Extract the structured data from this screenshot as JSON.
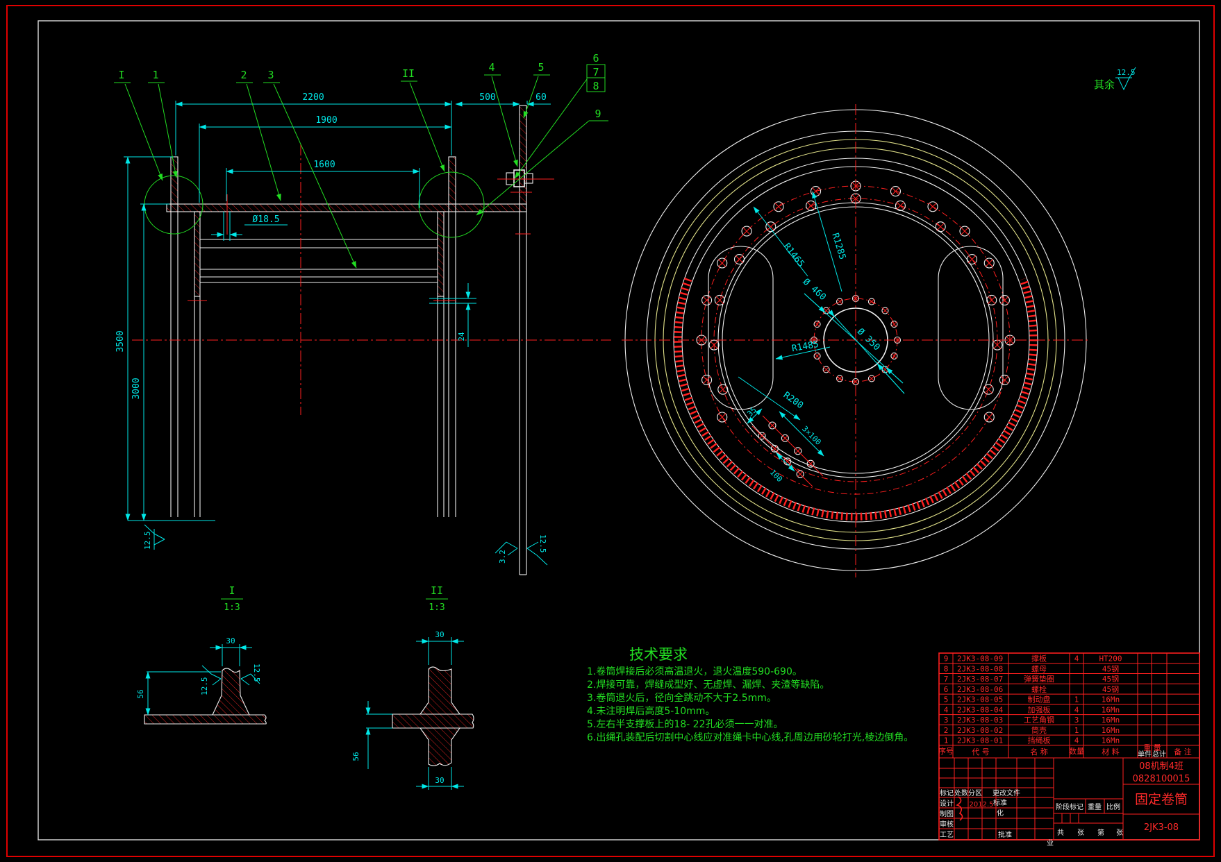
{
  "note": {
    "prefix": "其余",
    "value": "12.5"
  },
  "balloons": {
    "s1": "I",
    "n1": "1",
    "n2": "2",
    "n3": "3",
    "s2": "II",
    "n4": "4",
    "n5": "5",
    "n6": "6",
    "n7": "7",
    "n8": "8",
    "n9": "9"
  },
  "front": {
    "d2200": "2200",
    "d1900": "1900",
    "d1600": "1600",
    "d500": "500",
    "d60": "60",
    "hole": "Ø18.5",
    "v3500": "3500",
    "v3000": "3000",
    "d24": "24",
    "surf_bl": "12.5",
    "surf_32": "3.2",
    "surf_125": "12.5"
  },
  "circle": {
    "r1285": "R1285",
    "r1465": "R1465",
    "d460": "Ø 460",
    "d350": "Ø 350",
    "r1485": "R1485",
    "r200": "R200",
    "d35": "35",
    "d3x100": "3×100",
    "d100": "100"
  },
  "details": {
    "d1": {
      "label": "I",
      "scale": "1:3",
      "w30": "30",
      "h56": "56",
      "sl": "12.5",
      "sr": "12.5"
    },
    "d2": {
      "label": "II",
      "scale": "1:3",
      "wt": "30",
      "wb": "30",
      "h56": "56"
    }
  },
  "tech": {
    "title": "技术要求",
    "lines": [
      "1.卷筒焊接后必须高温退火，退火温度590-690。",
      "2.焊接可靠，焊缝成型好、无虚焊、漏焊、夹渣等缺陷。",
      "3.卷筒退火后，径向全跳动不大于2.5mm。",
      "4.未注明焊后高度5-10mm。",
      "5.左右半支撑板上的18-  22孔必须一一对准。",
      "6.出绳孔装配后切割中心线应对准绳卡中心线,孔周边用砂轮打光,棱边倒角。"
    ]
  },
  "bom": {
    "headers": {
      "no": "序号",
      "code": "代  号",
      "name": "名  称",
      "qty": "数量",
      "material": "材  料",
      "weight": "重 量",
      "weight_sub1": "单件",
      "weight_sub2": "总计",
      "notes": "备 注"
    },
    "rows": [
      {
        "no": "9",
        "code": "2JK3-08-09",
        "name": "撑板",
        "qty": "4",
        "material": "HT200"
      },
      {
        "no": "8",
        "code": "2JK3-08-08",
        "name": "螺母",
        "qty": "",
        "material": "45钢"
      },
      {
        "no": "7",
        "code": "2JK3-08-07",
        "name": "弹簧垫圈",
        "qty": "",
        "material": "45钢"
      },
      {
        "no": "6",
        "code": "2JK3-08-06",
        "name": "螺栓",
        "qty": "",
        "material": "45钢"
      },
      {
        "no": "5",
        "code": "2JK3-08-05",
        "name": "制动盘",
        "qty": "1",
        "material": "16Mn"
      },
      {
        "no": "4",
        "code": "2JK3-08-04",
        "name": "加强板",
        "qty": "4",
        "material": "16Mn"
      },
      {
        "no": "3",
        "code": "2JK3-08-03",
        "name": "工艺角钢",
        "qty": "3",
        "material": "16Mn"
      },
      {
        "no": "2",
        "code": "2JK3-08-02",
        "name": "筒壳",
        "qty": "1",
        "material": "16Mn"
      },
      {
        "no": "1",
        "code": "2JK3-08-01",
        "name": "挡绳板",
        "qty": "4",
        "material": "16Mn"
      }
    ]
  },
  "tb": {
    "mark": "标记",
    "count": "处数",
    "zone": "分区",
    "change_doc": "更改文件",
    "design": "设计",
    "draw": "制图",
    "check": "审核",
    "process": "工艺",
    "standard_1": "标准",
    "standard_2": "化",
    "approve": "批准",
    "sign_date": "2012.5",
    "stage_mark": "阶段标记",
    "weight": "重量",
    "scale": "比例",
    "sheet_total": "共",
    "sheet_zhang1": "张",
    "sheet_page": "第",
    "sheet_zhang2": "张",
    "class_name": "08机制4班",
    "student_id": "0828100015",
    "part_name": "固定卷筒",
    "drawing_no": "2JK3-08",
    "stamp": "业"
  },
  "colors": {
    "background": "#000000",
    "line": "#f0f0f0",
    "cad_red": "#ff1f1f",
    "cad_green": "#22dd22",
    "cad_cyan": "#00e8e8",
    "cad_yellow": "#e2e28a",
    "bom_red": "#ff2a2a"
  }
}
